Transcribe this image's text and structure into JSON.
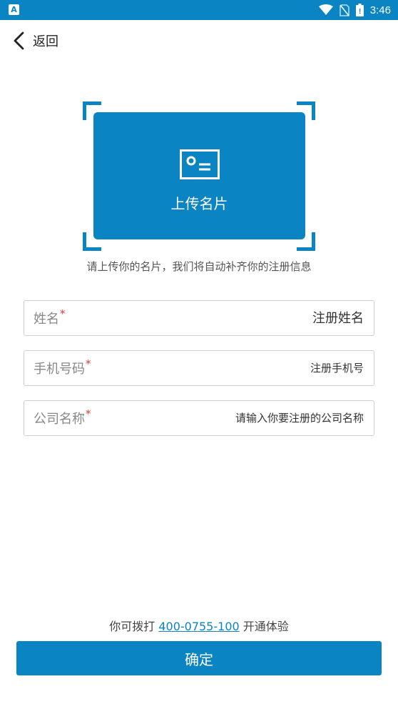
{
  "status_bar": {
    "time": "3:46",
    "app_icon": "A"
  },
  "nav": {
    "back_label": "返回"
  },
  "upload": {
    "label": "上传名片",
    "hint": "请上传你的名片，我们将自动补齐你的注册信息"
  },
  "form": {
    "required_mark": "*",
    "fields": [
      {
        "label": "姓名",
        "placeholder": "注册姓名"
      },
      {
        "label": "手机号码",
        "placeholder": "注册手机号"
      },
      {
        "label": "公司名称",
        "placeholder": "请输入你要注册的公司名称"
      }
    ]
  },
  "contact": {
    "prefix": "你可拨打",
    "phone": "400-0755-100",
    "suffix": "开通体验"
  },
  "confirm_label": "确定",
  "colors": {
    "primary": "#0a84c2",
    "required": "#e53935"
  }
}
